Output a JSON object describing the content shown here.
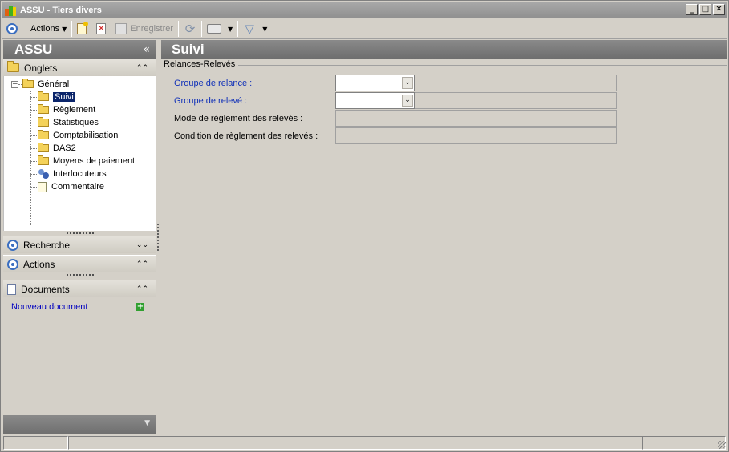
{
  "window": {
    "title": "ASSU -  Tiers divers",
    "controls": [
      "_",
      "□",
      "✕"
    ]
  },
  "toolbar": {
    "actions_label": "Actions",
    "save_label": "Enregistrer"
  },
  "sidebar": {
    "header_title": "ASSU",
    "collapse_glyph": "«",
    "tabs_panel_label": "Onglets",
    "tree": {
      "root_label": "Général",
      "items": [
        {
          "label": "Suivi",
          "selected": true,
          "icon": "folder-open-icon"
        },
        {
          "label": "Règlement",
          "icon": "folder-icon"
        },
        {
          "label": "Statistiques",
          "icon": "folder-icon"
        },
        {
          "label": "Comptabilisation",
          "icon": "folder-icon"
        },
        {
          "label": "DAS2",
          "icon": "folder-icon"
        },
        {
          "label": "Moyens de paiement",
          "icon": "folder-icon"
        },
        {
          "label": "Interlocuteurs",
          "icon": "people-icon"
        },
        {
          "label": "Commentaire",
          "icon": "note-icon"
        }
      ]
    },
    "search_panel_label": "Recherche",
    "actions_panel_label": "Actions",
    "documents_panel_label": "Documents",
    "new_document_label": "Nouveau document"
  },
  "main": {
    "title": "Suivi",
    "group_title": "Relances-Relevés",
    "fields": [
      {
        "label": "Groupe de relance :",
        "value": "",
        "type": "combo",
        "link": true
      },
      {
        "label": "Groupe de relevé :",
        "value": "",
        "type": "combo",
        "link": true
      },
      {
        "label": "Mode de règlement des relevés :",
        "value": "",
        "type": "readonly",
        "link": false
      },
      {
        "label": "Condition de règlement des relevés :",
        "value": "",
        "type": "readonly",
        "link": false
      }
    ]
  },
  "colors": {
    "header_gray": "#7c7c7c",
    "selection": "#0a246a",
    "link_blue": "#1030b8",
    "window_bg": "#d4d0c8"
  }
}
